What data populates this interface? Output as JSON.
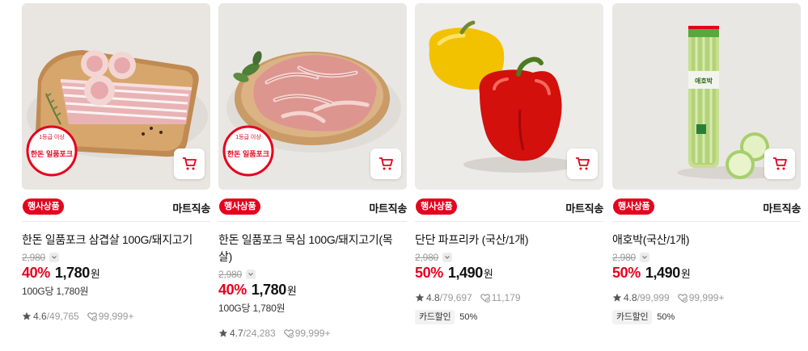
{
  "colors": {
    "accent": "#e5001d",
    "muted": "#999999"
  },
  "products": [
    {
      "event_badge": "행사상품",
      "delivery": "마트직송",
      "name": "한돈 일품포크 삼겹살 100G/돼지고기",
      "original_price": "2,980",
      "discount": "40%",
      "price": "1,780",
      "currency": "원",
      "unit_price": "100G당 1,780원",
      "rating": "4.6",
      "reviews": "/49,765",
      "likes": "99,999+",
      "label_top": "1등급 이상",
      "label_main": "한돈 일품포크",
      "card_tag": "",
      "card_rate": ""
    },
    {
      "event_badge": "행사상품",
      "delivery": "마트직송",
      "name": "한돈 일품포크 목심 100G/돼지고기(목살)",
      "original_price": "2,980",
      "discount": "40%",
      "price": "1,780",
      "currency": "원",
      "unit_price": "100G당 1,780원",
      "rating": "4.7",
      "reviews": "/24,283",
      "likes": "99,999+",
      "label_top": "1등급 이상",
      "label_main": "한돈 일품포크",
      "card_tag": "",
      "card_rate": ""
    },
    {
      "event_badge": "행사상품",
      "delivery": "마트직송",
      "name": "단단 파프리카 (국산/1개)",
      "original_price": "2,980",
      "discount": "50%",
      "price": "1,490",
      "currency": "원",
      "unit_price": "",
      "rating": "4.8",
      "reviews": "/79,697",
      "likes": "11,179",
      "card_tag": "카드할인",
      "card_rate": "50%"
    },
    {
      "event_badge": "행사상품",
      "delivery": "마트직송",
      "name": "애호박(국산/1개)",
      "original_price": "2,980",
      "discount": "50%",
      "price": "1,490",
      "currency": "원",
      "unit_price": "",
      "rating": "4.8",
      "reviews": "/99,999",
      "likes": "99,999+",
      "package_text": "애호박",
      "card_tag": "카드할인",
      "card_rate": "50%"
    }
  ]
}
